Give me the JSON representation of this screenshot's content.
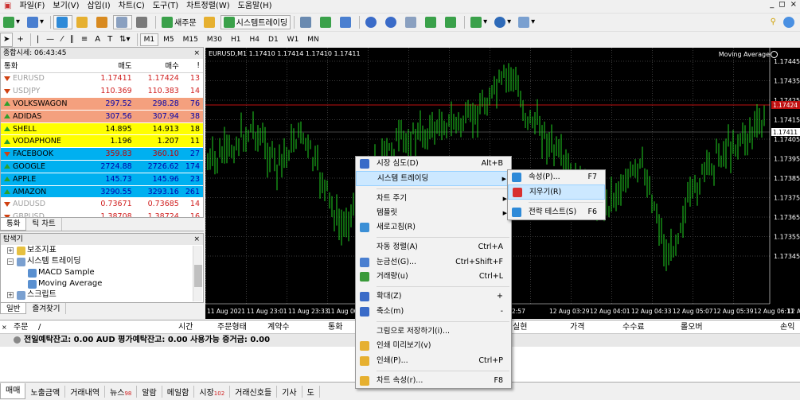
{
  "menubar": {
    "items": [
      "파일(F)",
      "보기(V)",
      "삽입(I)",
      "차트(C)",
      "도구(T)",
      "차트정렬(W)",
      "도움말(H)"
    ],
    "window_controls": [
      "_",
      "◻",
      "×"
    ]
  },
  "toolbar": {
    "new_order": "새주문",
    "auto_trading": "시스템트레이딩",
    "periods": [
      "M1",
      "M5",
      "M15",
      "M30",
      "H1",
      "H4",
      "D1",
      "W1",
      "MN"
    ]
  },
  "market_watch": {
    "title": "종합시세: 06:43:45",
    "close": "×",
    "headers": [
      "통화",
      "매도",
      "매수",
      "!"
    ],
    "rows": [
      {
        "symbol": "EURUSD",
        "bid": "1.17411",
        "ask": "1.17424",
        "spread": "13",
        "dir": "dn",
        "bg": "#ffffff",
        "muted": true
      },
      {
        "symbol": "USDJPY",
        "bid": "110.369",
        "ask": "110.383",
        "spread": "14",
        "dir": "dn",
        "bg": "#ffffff",
        "muted": true
      },
      {
        "symbol": "VOLKSWAGON",
        "bid": "297.52",
        "ask": "298.28",
        "spread": "76",
        "dir": "up",
        "bg": "#f4a07e",
        "muted": false
      },
      {
        "symbol": "ADIDAS",
        "bid": "307.56",
        "ask": "307.94",
        "spread": "38",
        "dir": "up",
        "bg": "#f4a07e",
        "muted": false
      },
      {
        "symbol": "SHELL",
        "bid": "14.895",
        "ask": "14.913",
        "spread": "18",
        "dir": "up",
        "bg": "#ffff00",
        "muted": false
      },
      {
        "symbol": "VODAPHONE",
        "bid": "1.196",
        "ask": "1.207",
        "spread": "11",
        "dir": "up",
        "bg": "#ffff00",
        "muted": false
      },
      {
        "symbol": "FACEBOOK",
        "bid": "359.83",
        "ask": "360.10",
        "spread": "27",
        "dir": "dn",
        "bg": "#00b0f0",
        "muted": false
      },
      {
        "symbol": "GOOGLE",
        "bid": "2724.88",
        "ask": "2726.62",
        "spread": "174",
        "dir": "up",
        "bg": "#00b0f0",
        "muted": false
      },
      {
        "symbol": "APPLE",
        "bid": "145.73",
        "ask": "145.96",
        "spread": "23",
        "dir": "up",
        "bg": "#00b0f0",
        "muted": false
      },
      {
        "symbol": "AMAZON",
        "bid": "3290.55",
        "ask": "3293.16",
        "spread": "261",
        "dir": "up",
        "bg": "#00b0f0",
        "muted": false
      },
      {
        "symbol": "AUDUSD",
        "bid": "0.73671",
        "ask": "0.73685",
        "spread": "14",
        "dir": "dn",
        "bg": "#ffffff",
        "muted": true
      },
      {
        "symbol": "GBPUSD",
        "bid": "1.38708",
        "ask": "1.38724",
        "spread": "16",
        "dir": "dn",
        "bg": "#ffffff",
        "muted": true
      }
    ],
    "tabs": [
      "통화",
      "틱 차트"
    ]
  },
  "navigator": {
    "title": "탐색기",
    "close": "×",
    "items": [
      {
        "label": "보조지표",
        "level": 1,
        "exp": "+"
      },
      {
        "label": "시스템 트레이딩",
        "level": 1,
        "exp": "−"
      },
      {
        "label": "MACD Sample",
        "level": 2,
        "exp": ""
      },
      {
        "label": "Moving Average",
        "level": 2,
        "exp": ""
      },
      {
        "label": "스크립트",
        "level": 1,
        "exp": "+"
      }
    ],
    "tabs": [
      "일반",
      "즐겨찾기"
    ]
  },
  "chart": {
    "header": "EURUSD,M1  1.17410 1.17414 1.17410 1.17411",
    "ea_label": "Moving Average",
    "price_labels": [
      "1.17445",
      "1.17435",
      "1.17425",
      "1.17415",
      "1.17405",
      "1.17395",
      "1.17385",
      "1.17375",
      "1.17365",
      "1.17355",
      "1.17345"
    ],
    "marker_ask": "1.17424",
    "marker_bid": "1.17411",
    "time_labels": [
      "11 Aug 2021",
      "11 Aug 23:01",
      "11 Aug 23:33",
      "11 Aug 00",
      "2:57",
      "12 Aug 03:29",
      "12 Aug 04:01",
      "12 Aug 04:33",
      "12 Aug 05:07",
      "12 Aug 05:39",
      "12 Aug 06:11",
      "12 Au"
    ]
  },
  "context_menu": {
    "items": [
      {
        "label": "시장 심도(D)",
        "shortcut": "Alt+B",
        "icon": "#3a6bc8",
        "sub": false,
        "hl": false
      },
      {
        "label": "시스템 트레이딩",
        "shortcut": "",
        "icon": "",
        "sub": true,
        "hl": true
      },
      {
        "divider": true
      },
      {
        "label": "차트 주기",
        "shortcut": "",
        "icon": "",
        "sub": true,
        "hl": false
      },
      {
        "label": "템플릿",
        "shortcut": "",
        "icon": "",
        "sub": true,
        "hl": false
      },
      {
        "label": "새로고침(R)",
        "shortcut": "",
        "icon": "#3b8fd6",
        "sub": false,
        "hl": false
      },
      {
        "divider": true
      },
      {
        "label": "자동 정렬(A)",
        "shortcut": "Ctrl+A",
        "icon": "",
        "sub": false,
        "hl": false
      },
      {
        "label": "눈금선(G)...",
        "shortcut": "Ctrl+Shift+F",
        "icon": "#4a7fd0",
        "sub": false,
        "hl": false
      },
      {
        "label": "거래량(u)",
        "shortcut": "Ctrl+L",
        "icon": "#3a9a3a",
        "sub": false,
        "hl": false
      },
      {
        "divider": true
      },
      {
        "label": "확대(Z)",
        "shortcut": "+",
        "icon": "#3a6bc8",
        "sub": false,
        "hl": false
      },
      {
        "label": "축소(m)",
        "shortcut": "-",
        "icon": "#3a6bc8",
        "sub": false,
        "hl": false
      },
      {
        "divider": true
      },
      {
        "label": "그림으로 저장하기(i)...",
        "shortcut": "",
        "icon": "",
        "sub": false,
        "hl": false
      },
      {
        "label": "인쇄 미리보기(v)",
        "shortcut": "",
        "icon": "#e6b030",
        "sub": false,
        "hl": false
      },
      {
        "label": "인쇄(P)...",
        "shortcut": "Ctrl+P",
        "icon": "#e6b030",
        "sub": false,
        "hl": false
      },
      {
        "divider": true
      },
      {
        "label": "차트 속성(r)...",
        "shortcut": "F8",
        "icon": "#e6b030",
        "sub": false,
        "hl": false
      }
    ]
  },
  "submenu": {
    "items": [
      {
        "label": "속성(P)...",
        "shortcut": "F7",
        "icon": "#2e8ad8",
        "hl": false
      },
      {
        "label": "지우기(R)",
        "shortcut": "",
        "icon": "#d83030",
        "hl": true
      },
      {
        "divider": true
      },
      {
        "label": "전략 테스트(S)",
        "shortcut": "F6",
        "icon": "#2e8ad8",
        "hl": false
      }
    ]
  },
  "terminal": {
    "headers": [
      "주문",
      "/",
      "시간",
      "주문형태",
      "계약수",
      "통화",
      "실현",
      "가격",
      "수수료",
      "롤오버",
      "손익"
    ],
    "balance": "전일예탁잔고: 0.00 AUD  평가예탁잔고: 0.00  사용가능 증거금: 0.00",
    "tabs": [
      {
        "label": "매매",
        "badge": ""
      },
      {
        "label": "노출금액",
        "badge": ""
      },
      {
        "label": "거래내역",
        "badge": ""
      },
      {
        "label": "뉴스",
        "badge": "98"
      },
      {
        "label": "알람",
        "badge": ""
      },
      {
        "label": "메일함",
        "badge": ""
      },
      {
        "label": "시장",
        "badge": "102"
      },
      {
        "label": "거래신호들",
        "badge": ""
      },
      {
        "label": "기사",
        "badge": ""
      },
      {
        "label": "도",
        "badge": ""
      }
    ]
  }
}
